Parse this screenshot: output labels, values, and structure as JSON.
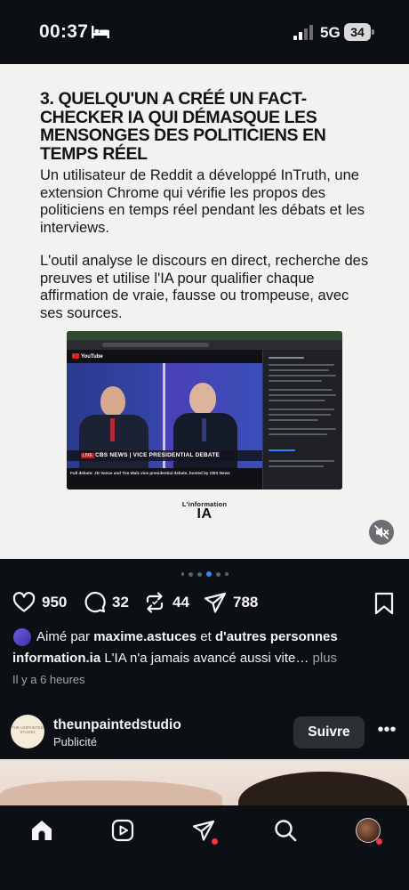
{
  "status_bar": {
    "time": "00:37",
    "network": "5G",
    "battery": "34",
    "icons": [
      "bed-icon",
      "signal-icon",
      "battery-icon"
    ]
  },
  "post": {
    "heading": "3. Quelqu'un a créé un fact-checker IA qui démasque les mensonges des politiciens en temps réel",
    "paragraph1": "Un utilisateur de Reddit a développé InTruth, une extension Chrome qui vérifie les propos des politiciens en temps réel pendant les débats et les interviews.",
    "paragraph2": "L'outil analyse le discours en direct, recherche des preuves et utilise l'IA pour qualifier chaque affirmation de vraie, fausse ou trompeuse, avec ses sources.",
    "video": {
      "site": "YouTube",
      "live": "LIVE",
      "ticker": "CBS NEWS | VICE PRESIDENTIAL DEBATE",
      "caption": "Full debate: JD Vance and Tim Walz vice presidential debate, hosted by CBS News"
    },
    "brand_small": "L'information",
    "brand_big": "IA",
    "carousel": {
      "count": 6,
      "active_index": 2
    }
  },
  "actions": {
    "likes": "950",
    "comments": "32",
    "reposts": "44",
    "shares": "788"
  },
  "liked_by": {
    "prefix": "Aimé par",
    "user": "maxime.astuces",
    "connector": "et",
    "others": "d'autres personnes"
  },
  "caption": {
    "user": "information.ia",
    "text": "L'IA n'a jamais avancé aussi vite…",
    "more": "plus"
  },
  "time_ago": "Il y a 6 heures",
  "next_post": {
    "avatar_text": "THE UNPAINTED STUDIO",
    "username": "theunpaintedstudio",
    "subtitle": "Publicité",
    "follow_label": "Suivre",
    "more_label": "•••"
  },
  "nav": {
    "items": [
      "home-icon",
      "reels-icon",
      "direct-icon",
      "search-icon",
      "profile-avatar"
    ],
    "accent": "#ff3040"
  }
}
